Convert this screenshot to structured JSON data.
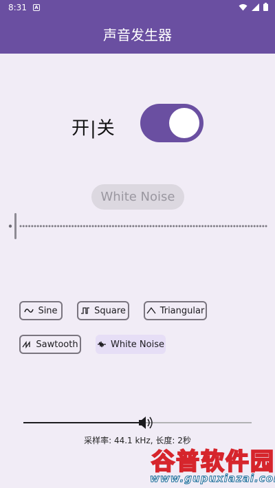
{
  "status_bar": {
    "time": "8:31",
    "notification_icon": "a-icon",
    "right_icons": [
      "wifi-icon",
      "signal-icon",
      "battery-icon"
    ]
  },
  "app_bar": {
    "title": "声音发生器"
  },
  "power_toggle": {
    "label": "开|关",
    "state": "on"
  },
  "waveform": {
    "current": "White Noise"
  },
  "wave_types": [
    {
      "label": "Sine",
      "icon": "sine-wave-icon",
      "selected": false
    },
    {
      "label": "Square",
      "icon": "square-wave-icon",
      "selected": false
    },
    {
      "label": "Triangular",
      "icon": "triangle-wave-icon",
      "selected": false
    },
    {
      "label": "Sawtooth",
      "icon": "sawtooth-wave-icon",
      "selected": false
    },
    {
      "label": "White Noise",
      "icon": "noise-wave-icon",
      "selected": true
    }
  ],
  "volume": {
    "value": 0.53,
    "icon": "speaker-icon"
  },
  "info": {
    "text": "采样率: 44.1 kHz, 长度: 2秒"
  },
  "watermark": {
    "title": "谷普软件园",
    "url": "www.gupuxiazai.com"
  },
  "colors": {
    "primary": "#6a4fa1",
    "background": "#f1ecf6",
    "chip_selected": "#e6def6"
  }
}
